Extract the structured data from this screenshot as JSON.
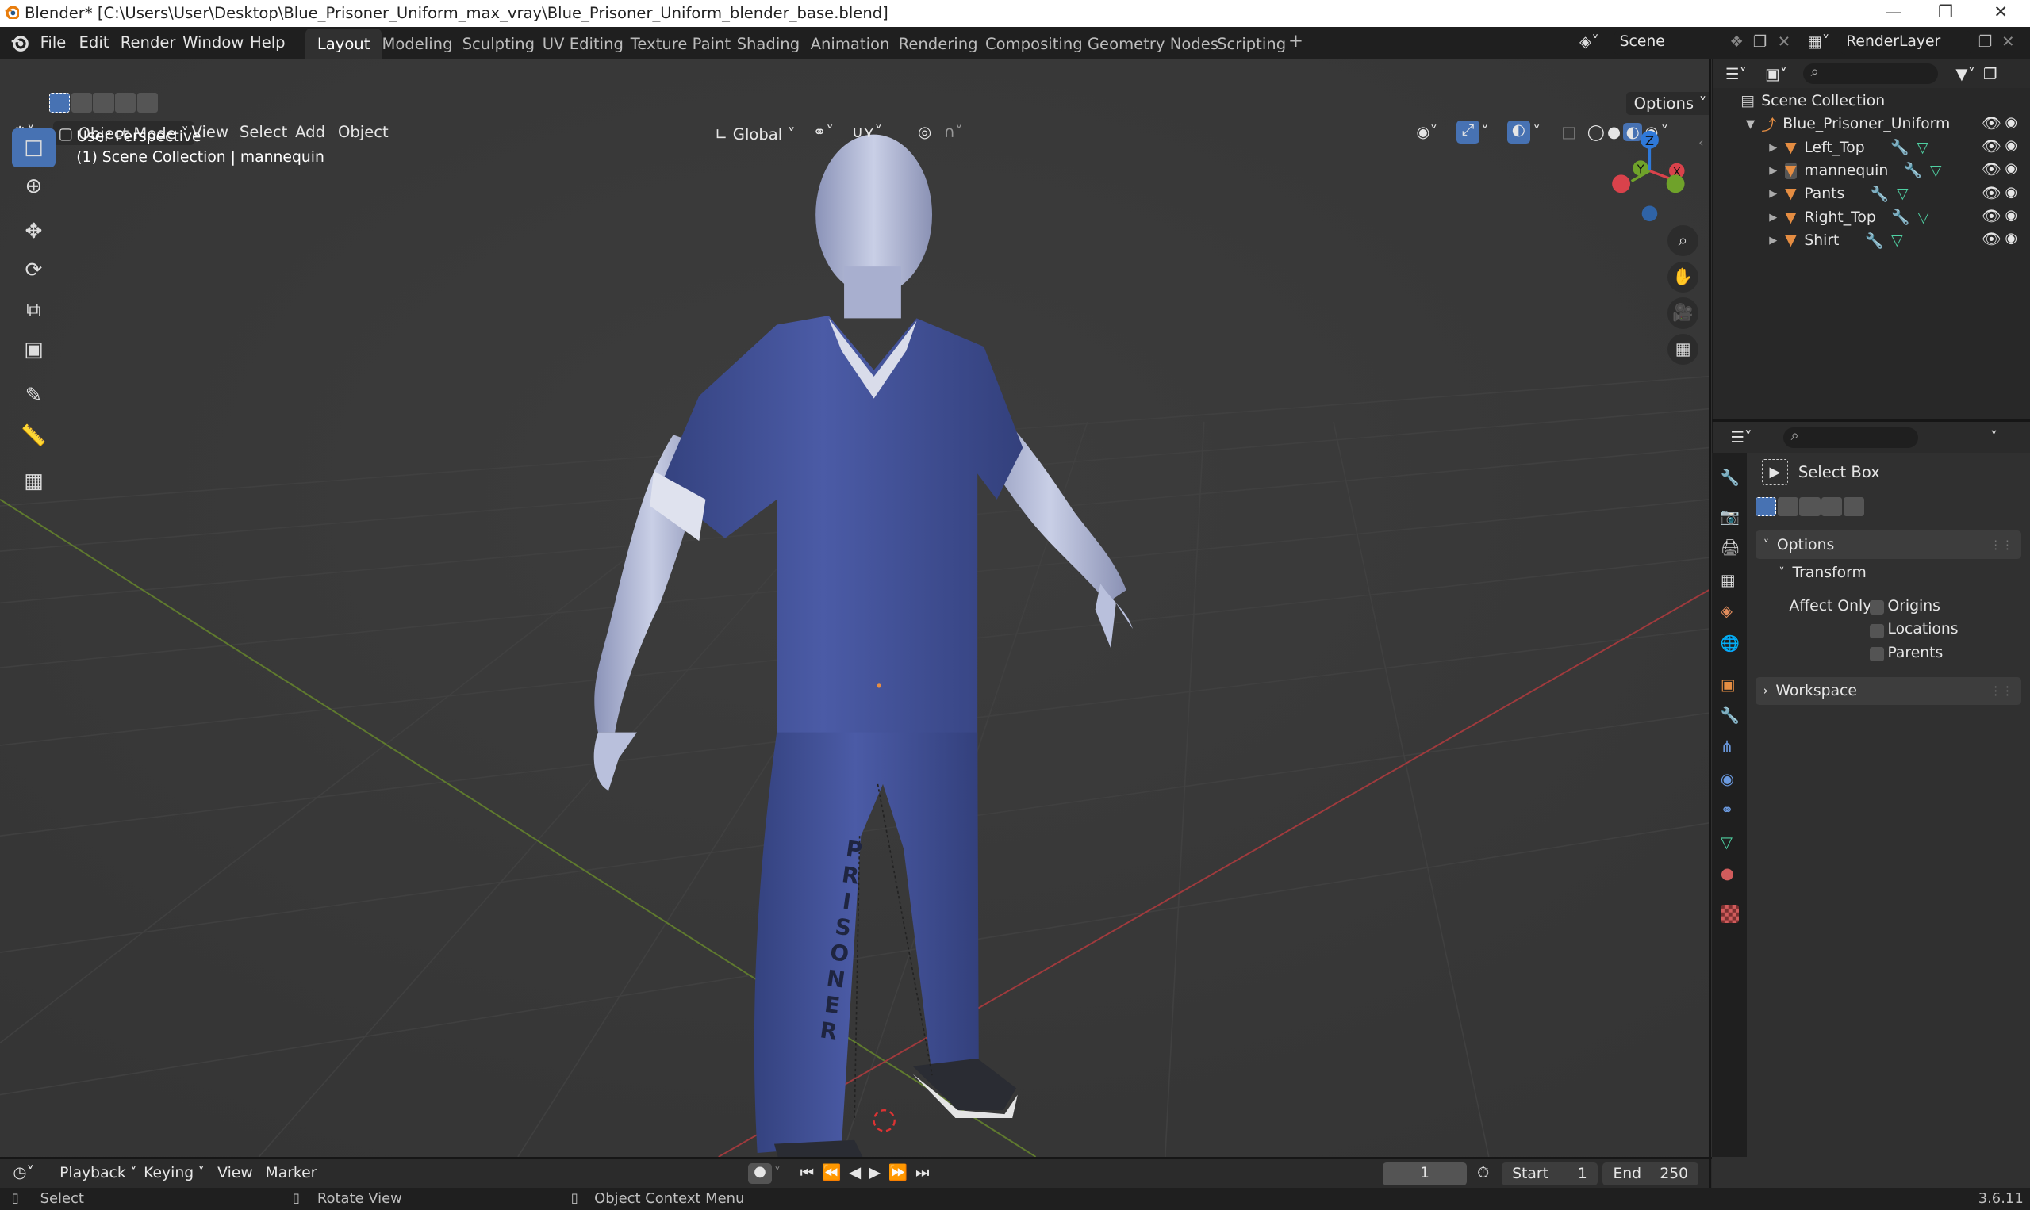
{
  "window": {
    "title": "Blender* [C:\\Users\\User\\Desktop\\Blue_Prisoner_Uniform_max_vray\\Blue_Prisoner_Uniform_blender_base.blend]",
    "controls": [
      "minimize-icon",
      "maximize-icon",
      "close-icon"
    ]
  },
  "menubar": {
    "items": [
      "File",
      "Edit",
      "Render",
      "Window",
      "Help"
    ],
    "workspaces": [
      "Layout",
      "Modeling",
      "Sculpting",
      "UV Editing",
      "Texture Paint",
      "Shading",
      "Animation",
      "Rendering",
      "Compositing",
      "Geometry Nodes",
      "Scripting"
    ],
    "active_workspace": "Layout",
    "add_tab": "+",
    "scene": "Scene",
    "view_layer": "RenderLayer"
  },
  "viewport": {
    "mode": "Object Mode",
    "menus": [
      "View",
      "Select",
      "Add",
      "Object"
    ],
    "transform_orientation": "Global",
    "options_label": "Options",
    "overlay_line1": "User Perspective",
    "overlay_line2": "(1) Scene Collection | mannequin",
    "tools": [
      "select-box-icon",
      "cursor-icon",
      "move-icon",
      "rotate-icon",
      "scale-icon",
      "transform-icon",
      "annotate-icon",
      "measure-icon",
      "add-cube-icon"
    ],
    "active_tool": "select-box-icon",
    "gizmo_axes": [
      "Z",
      "Y",
      "X"
    ],
    "prisoner_text": "PRISONER"
  },
  "outliner": {
    "root": "Scene Collection",
    "collection": "Blue_Prisoner_Uniform",
    "objects": [
      {
        "name": "Left_Top"
      },
      {
        "name": "mannequin"
      },
      {
        "name": "Pants"
      },
      {
        "name": "Right_Top"
      },
      {
        "name": "Shirt"
      }
    ]
  },
  "properties": {
    "tool_name": "Select Box",
    "panels": {
      "options": "Options",
      "transform": "Transform",
      "affect_only": "Affect Only",
      "origins": "Origins",
      "locations": "Locations",
      "parents": "Parents",
      "workspace": "Workspace"
    }
  },
  "timeline": {
    "menus": [
      "Playback",
      "Keying",
      "View",
      "Marker"
    ],
    "current_frame": "1",
    "start_label": "Start",
    "start_value": "1",
    "end_label": "End",
    "end_value": "250"
  },
  "statusbar": {
    "select": "Select",
    "rotate": "Rotate View",
    "context": "Object Context Menu",
    "version": "3.6.11"
  },
  "colors": {
    "accent": "#4772b3",
    "uniform": "#3f4f94",
    "x_axis": "#d9424b",
    "y_axis": "#6fa22a",
    "z_axis": "#2f79d9",
    "mesh_orange": "#e58d42"
  }
}
